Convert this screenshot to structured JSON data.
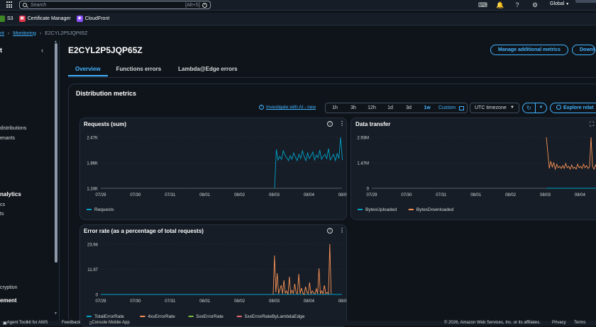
{
  "topbar": {
    "search_placeholder": "Search",
    "search_shortcut": "[Alt+S]",
    "region": "Global"
  },
  "favorites": [
    {
      "label": "S3",
      "color": "#3f8624"
    },
    {
      "label": "Certificate Manager",
      "color": "#dd344c"
    },
    {
      "label": "CloudFront",
      "color": "#8c4fff"
    }
  ],
  "breadcrumbs": {
    "first": "nt",
    "second": "Monitoring",
    "current": "E2CYL2P5JQP65Z"
  },
  "sidebar": {
    "title": "t",
    "items": [
      "distributions",
      "enants"
    ],
    "section": "nalytics",
    "sub_items": [
      "cs",
      "ts"
    ],
    "bottom_item": "cryption",
    "bottom_section": "ement"
  },
  "page": {
    "title": "E2CYL2P5JQP65Z",
    "manage_metrics": "Manage additional metrics",
    "download": "Downl"
  },
  "tabs": [
    {
      "label": "Overview",
      "active": true
    },
    {
      "label": "Functions errors",
      "active": false
    },
    {
      "label": "Lambda@Edge errors",
      "active": false
    }
  ],
  "panel": {
    "title": "Distribution metrics",
    "investigate": "Investigate with AI - new",
    "ranges": [
      "1h",
      "3h",
      "12h",
      "1d",
      "3d",
      "1w"
    ],
    "selected_range": "1w",
    "custom": "Custom",
    "timezone": "UTC timezone",
    "explore": "Explore relat"
  },
  "cards": {
    "requests": {
      "title": "Requests (sum)",
      "yticks": [
        "2.47K",
        "1.86K",
        "1.24K"
      ],
      "xticks": [
        "07/29",
        "07/30",
        "07/31",
        "08/01",
        "08/02",
        "08/03",
        "08/04",
        "08/05"
      ],
      "legend": [
        "Requests"
      ],
      "colors": [
        "#00a1c9"
      ]
    },
    "transfer": {
      "title": "Data transfer",
      "yticks": [
        "2.93M",
        "1.47M",
        "0"
      ],
      "xticks": [
        "07/29",
        "07/30",
        "07/31",
        "08/01",
        "08/02",
        "08/03",
        "08/04"
      ],
      "legend": [
        "BytesUploaded",
        "BytesDownloaded"
      ],
      "colors": [
        "#00a1c9",
        "#f89256"
      ]
    },
    "errors": {
      "title": "Error rate (as a percentage of total requests)",
      "yticks": [
        "23.94",
        "11.97",
        "0"
      ],
      "xticks": [
        "07/29",
        "07/30",
        "07/31",
        "08/01",
        "08/02",
        "08/03",
        "08/04",
        "08/05"
      ],
      "legend": [
        "TotalErrorRate",
        "4xxErrorRate",
        "5xxErrorRate",
        "5xxErrorRateByLambdaEdge"
      ],
      "colors": [
        "#00a1c9",
        "#f89256",
        "#7fbf3f",
        "#e56b6f"
      ]
    }
  },
  "footer": {
    "left": [
      "Agent Toolkit for AWS",
      "Feedback",
      "Console Mobile App"
    ],
    "copyright": "© 2026, Amazon Web Services, Inc. or its affiliates.",
    "privacy": "Privacy",
    "terms": "Terms"
  }
}
